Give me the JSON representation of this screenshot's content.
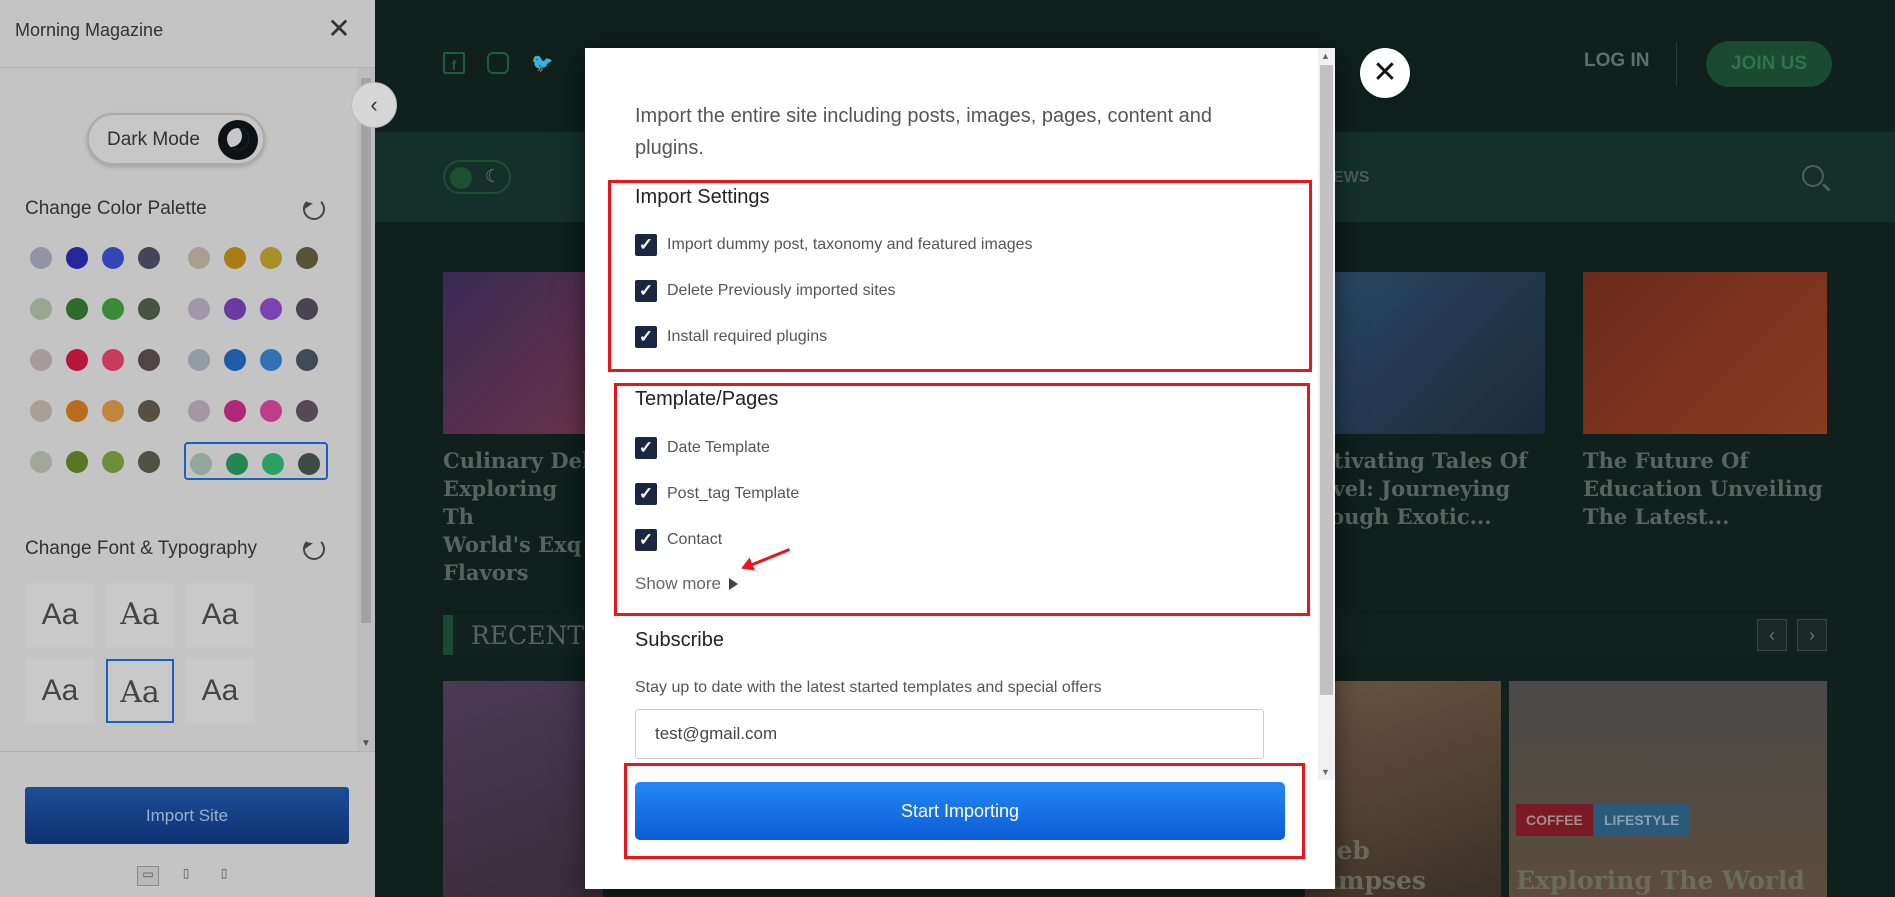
{
  "customizer": {
    "title": "Morning Magazine",
    "dark_mode_label": "Dark Mode",
    "color_palette_title": "Change Color Palette",
    "font_title": "Change Font & Typography",
    "font_sample": "Aa",
    "import_button": "Import Site",
    "palettes": [
      [
        "#9294a6",
        "#25259c",
        "#3446b6",
        "#45455a"
      ],
      [
        "#a89f8e",
        "#a97c14",
        "#a69128",
        "#585237"
      ],
      [
        "#98a692",
        "#2f6a2d",
        "#3b8a37",
        "#475242"
      ],
      [
        "#a097a9",
        "#6a3aa0",
        "#7b42b3",
        "#4a4452"
      ],
      [
        "#a89a9a",
        "#b8173a",
        "#c83b5c",
        "#524444"
      ],
      [
        "#929ba6",
        "#1f5ca6",
        "#3371b6",
        "#414a57"
      ],
      [
        "#a8a096",
        "#b76d1c",
        "#c0863b",
        "#55503f"
      ],
      [
        "#a496a2",
        "#b1267a",
        "#bd3d8a",
        "#574856"
      ],
      [
        "#a1a89a",
        "#5a7623",
        "#6d8d38",
        "#4f5142"
      ],
      [
        "#93a69c",
        "#238752",
        "#2fa064",
        "#3c4d45"
      ]
    ]
  },
  "modal": {
    "intro": "Import the entire site including posts, images, pages, content and plugins.",
    "import_settings_title": "Import Settings",
    "import_settings": [
      "Import dummy post, taxonomy and featured images",
      "Delete Previously imported sites",
      "Install required plugins"
    ],
    "templates_title": "Template/Pages",
    "templates": [
      "Date Template",
      "Post_tag Template",
      "Contact"
    ],
    "show_more": "Show more",
    "subscribe_title": "Subscribe",
    "subscribe_desc": "Stay up to date with the latest started templates and special offers",
    "email_value": "test@gmail.com",
    "start_button": "Start Importing",
    "check_glyph": "✓"
  },
  "preview": {
    "login": "LOG IN",
    "join": "JOIN US",
    "nav_fragment": "EWS",
    "cards": [
      "Culinary Del\nExploring Th\nWorld's Exq\nFlavors",
      "ptivating Tales Of\navel: Journeying\nrough Exotic...",
      "The Future Of\nEducation Unveiling\nThe Latest..."
    ],
    "recent_label": "RECENT",
    "tags": [
      "COFFEE",
      "LIFESTYLE"
    ],
    "big_titles": [
      "deb",
      "limpses",
      "Exploring The World"
    ]
  }
}
